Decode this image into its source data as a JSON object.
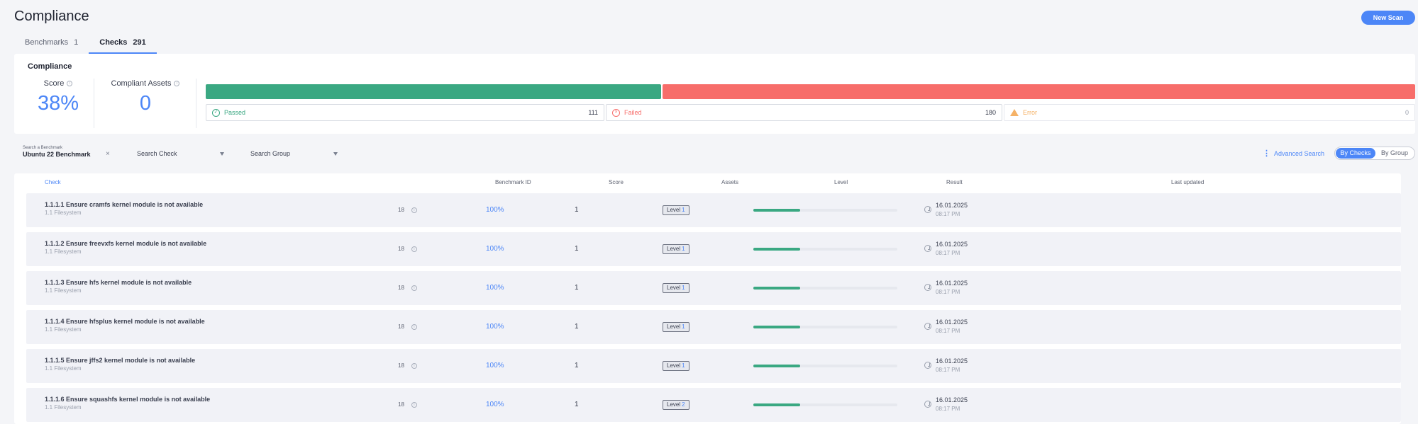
{
  "header": {
    "title": "Compliance",
    "new_scan_label": "New Scan"
  },
  "tabs": [
    {
      "label": "Benchmarks",
      "count": "1",
      "active": false
    },
    {
      "label": "Checks",
      "count": "291",
      "active": true
    }
  ],
  "summary": {
    "title": "Compliance",
    "score_label": "Score",
    "score_value": "38%",
    "assets_label": "Compliant Assets",
    "assets_value": "0",
    "passed_label": "Passed",
    "passed_count": "111",
    "failed_label": "Failed",
    "failed_count": "180",
    "error_label": "Error",
    "error_count": "0",
    "colors": {
      "passed": "#3aa882",
      "failed": "#f76d6a",
      "error": "#f5b267",
      "accent": "#4c86f7"
    }
  },
  "filters": {
    "benchmark_label": "Search a Benchmark",
    "benchmark_value": "Ubuntu 22 Benchmark",
    "clear_icon": "×",
    "search_check": "Search Check",
    "search_group": "Search Group",
    "advanced_search": "Advanced Search",
    "toggle_by_checks": "By Checks",
    "toggle_by_group": "By Group"
  },
  "table": {
    "headers": {
      "check": "Check",
      "benchmark_id": "Benchmark ID",
      "score": "Score",
      "assets": "Assets",
      "level": "Level",
      "result": "Result",
      "last_updated": "Last updated"
    },
    "rows": [
      {
        "title": "1.1.1.1 Ensure cramfs kernel module is not available",
        "group": "1.1 Filesystem",
        "benchmark_id": "18",
        "score": "100%",
        "assets": "1",
        "level_label": "Level",
        "level": "1",
        "date": "16.01.2025",
        "time": "08:17 PM"
      },
      {
        "title": "1.1.1.2 Ensure freevxfs kernel module is not available",
        "group": "1.1 Filesystem",
        "benchmark_id": "18",
        "score": "100%",
        "assets": "1",
        "level_label": "Level",
        "level": "1",
        "date": "16.01.2025",
        "time": "08:17 PM"
      },
      {
        "title": "1.1.1.3 Ensure hfs kernel module is not available",
        "group": "1.1 Filesystem",
        "benchmark_id": "18",
        "score": "100%",
        "assets": "1",
        "level_label": "Level",
        "level": "1",
        "date": "16.01.2025",
        "time": "08:17 PM"
      },
      {
        "title": "1.1.1.4 Ensure hfsplus kernel module is not available",
        "group": "1.1 Filesystem",
        "benchmark_id": "18",
        "score": "100%",
        "assets": "1",
        "level_label": "Level",
        "level": "1",
        "date": "16.01.2025",
        "time": "08:17 PM"
      },
      {
        "title": "1.1.1.5 Ensure jffs2 kernel module is not available",
        "group": "1.1 Filesystem",
        "benchmark_id": "18",
        "score": "100%",
        "assets": "1",
        "level_label": "Level",
        "level": "1",
        "date": "16.01.2025",
        "time": "08:17 PM"
      },
      {
        "title": "1.1.1.6 Ensure squashfs kernel module is not available",
        "group": "1.1 Filesystem",
        "benchmark_id": "18",
        "score": "100%",
        "assets": "1",
        "level_label": "Level",
        "level": "2",
        "date": "16.01.2025",
        "time": "08:17 PM"
      }
    ]
  }
}
